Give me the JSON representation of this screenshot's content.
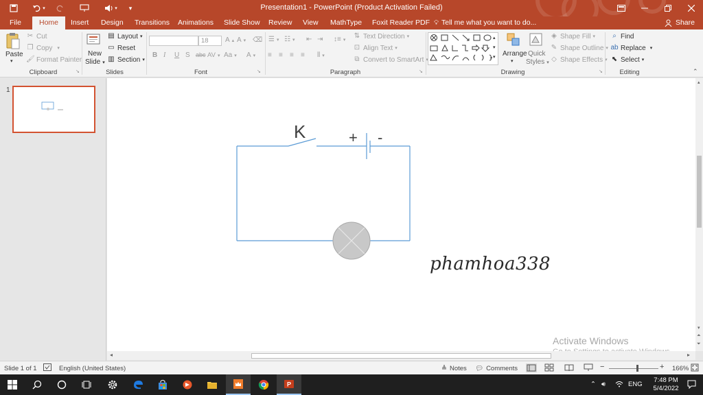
{
  "window": {
    "title": "Presentation1 - PowerPoint (Product Activation Failed)"
  },
  "tabs": [
    "File",
    "Home",
    "Insert",
    "Design",
    "Transitions",
    "Animations",
    "Slide Show",
    "Review",
    "View",
    "MathType",
    "Foxit Reader PDF"
  ],
  "active_tab": "Home",
  "tell_me": "Tell me what you want to do...",
  "share_label": "Share",
  "ribbon": {
    "clipboard": {
      "label": "Clipboard",
      "paste": "Paste",
      "cut": "Cut",
      "copy": "Copy",
      "format_painter": "Format Painter"
    },
    "slides": {
      "label": "Slides",
      "new_slide_1": "New",
      "new_slide_2": "Slide",
      "layout": "Layout",
      "reset": "Reset",
      "section": "Section"
    },
    "font": {
      "label": "Font",
      "font_size": "18",
      "bold": "B",
      "italic": "I",
      "underline": "U",
      "strike": "S",
      "abc": "abc",
      "av": "AV",
      "aa": "Aa",
      "color_a": "A"
    },
    "paragraph": {
      "label": "Paragraph",
      "text_direction": "Text Direction",
      "align_text": "Align Text",
      "convert_smartart": "Convert to SmartArt"
    },
    "drawing": {
      "label": "Drawing",
      "arrange": "Arrange",
      "quick_styles_1": "Quick",
      "quick_styles_2": "Styles",
      "shape_fill": "Shape Fill",
      "shape_outline": "Shape Outline",
      "shape_effects": "Shape Effects"
    },
    "editing": {
      "label": "Editing",
      "find": "Find",
      "replace": "Replace",
      "select": "Select"
    }
  },
  "thumbnail": {
    "number": "1"
  },
  "slide": {
    "switch_label": "K",
    "plus_label": "+",
    "minus_label": "-",
    "signature": "phamhoa338"
  },
  "watermark": {
    "line1": "Activate Windows",
    "line2": "Go to Settings to activate Windows."
  },
  "statusbar": {
    "slide_count": "Slide 1 of 1",
    "language": "English (United States)",
    "notes": "Notes",
    "comments": "Comments",
    "zoom": "166%"
  },
  "taskbar": {
    "language": "ENG",
    "time": "7:48 PM",
    "date": "5/4/2022"
  },
  "colors": {
    "accent": "#b7472a",
    "wire": "#5b9bd5",
    "bulb": "#c8c8c8"
  }
}
